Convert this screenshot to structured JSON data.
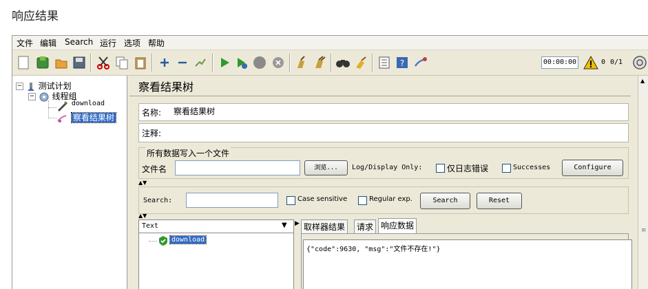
{
  "heading": "响应结果",
  "menu": [
    "文件",
    "编辑",
    "Search",
    "运行",
    "选项",
    "帮助"
  ],
  "toolbar": {
    "icons": [
      "new-icon",
      "templates-icon",
      "open-icon",
      "save-icon",
      "cut-icon",
      "copy-icon",
      "paste-icon",
      "expand-icon",
      "collapse-icon",
      "toggle-icon",
      "start-icon",
      "start-no-pause-icon",
      "stop-icon",
      "shutdown-icon",
      "clear-icon",
      "clear-all-icon",
      "search-binoculars-icon",
      "reset-search-icon",
      "function-helper-icon",
      "help-icon",
      "remote-icon"
    ],
    "timer": "00:00:00",
    "warning_count": "0",
    "threads": "0/1"
  },
  "tree": {
    "test_plan": "测试计划",
    "thread_group": "线程组",
    "sampler": "download",
    "listener": "察看结果树"
  },
  "panel": {
    "title": "察看结果树",
    "name_label": "名称:",
    "name_value": "察看结果树",
    "comment_label": "注释:",
    "comment_value": "",
    "file_section": "所有数据写入一个文件",
    "filename_label": "文件名",
    "filename_value": "",
    "browse_button": "浏览...",
    "log_display_label": "Log/Display Only:",
    "errors_only_label": "仅日志错误",
    "successes_label": "Successes",
    "configure_button": "Configure",
    "search_label": "Search:",
    "search_value": "",
    "case_sensitive_label": "Case sensitive",
    "regex_label": "Regular exp.",
    "search_button": "Search",
    "reset_button": "Reset",
    "renderer_selected": "Text",
    "result_item": "download",
    "tabs": [
      "取样器结果",
      "请求",
      "响应数据"
    ],
    "active_tab": "响应数据",
    "response_body": "{\"code\":9630, \"msg\":\"文件不存在!\"}"
  },
  "colors": {
    "selection": "#316ac5",
    "accent_green": "#2e9a2e"
  }
}
